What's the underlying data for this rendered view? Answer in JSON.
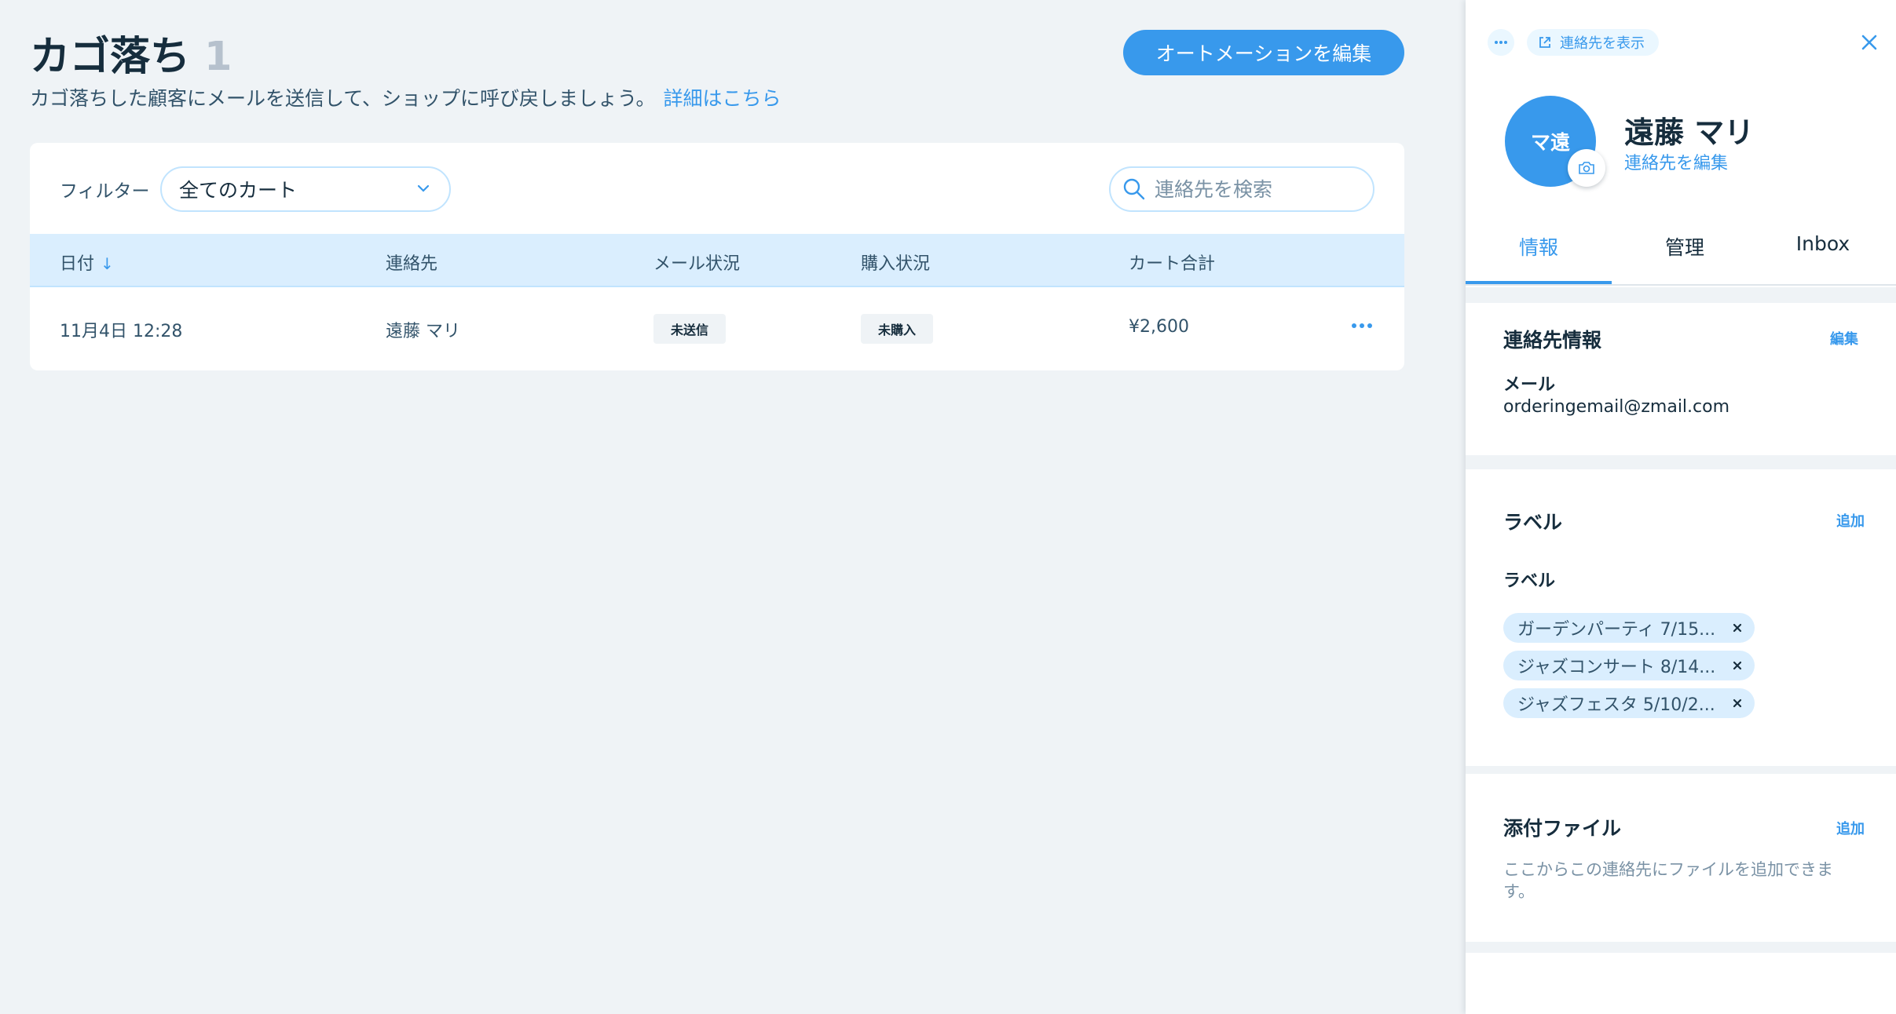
{
  "header": {
    "title": "カゴ落ち",
    "count": "1",
    "subtitle": "カゴ落ちした顧客にメールを送信して、ショップに呼び戻しましょう。",
    "learn_more": "詳細はこちら",
    "edit_automation_label": "オートメーションを編集"
  },
  "filter": {
    "label": "フィルター",
    "selected": "全てのカート"
  },
  "search": {
    "placeholder": "連絡先を検索"
  },
  "table": {
    "columns": {
      "date": "日付",
      "contact": "連絡先",
      "email_status": "メール状況",
      "purchase_status": "購入状況",
      "cart_total": "カート合計"
    },
    "rows": [
      {
        "date": "11月4日 12:28",
        "contact": "遠藤 マリ",
        "email_status": "未送信",
        "purchase_status": "未購入",
        "cart_total": "¥2,600"
      }
    ]
  },
  "panel": {
    "view_contact_label": "連絡先を表示",
    "avatar_initials": "マ遠",
    "name": "遠藤 マリ",
    "edit_contact_label": "連絡先を編集",
    "tabs": [
      "情報",
      "管理",
      "Inbox"
    ],
    "contact_info": {
      "title": "連絡先情報",
      "edit_label": "編集",
      "email_label": "メール",
      "email_value": "orderingemail@zmail.com"
    },
    "labels": {
      "title": "ラベル",
      "add_label": "追加",
      "field_label": "ラベル",
      "chips": [
        "ガーデンパーティ 7/15...",
        "ジャズコンサート 8/14...",
        "ジャズフェスタ 5/10/2..."
      ]
    },
    "attachments": {
      "title": "添付ファイル",
      "add_label": "追加",
      "empty_text": "ここからこの連絡先にファイルを追加できます。"
    }
  },
  "colors": {
    "accent": "#3899ec",
    "text_primary": "#162d3d",
    "text_secondary": "#32536a",
    "background": "#eff3f6",
    "header_row": "#daeefe"
  }
}
